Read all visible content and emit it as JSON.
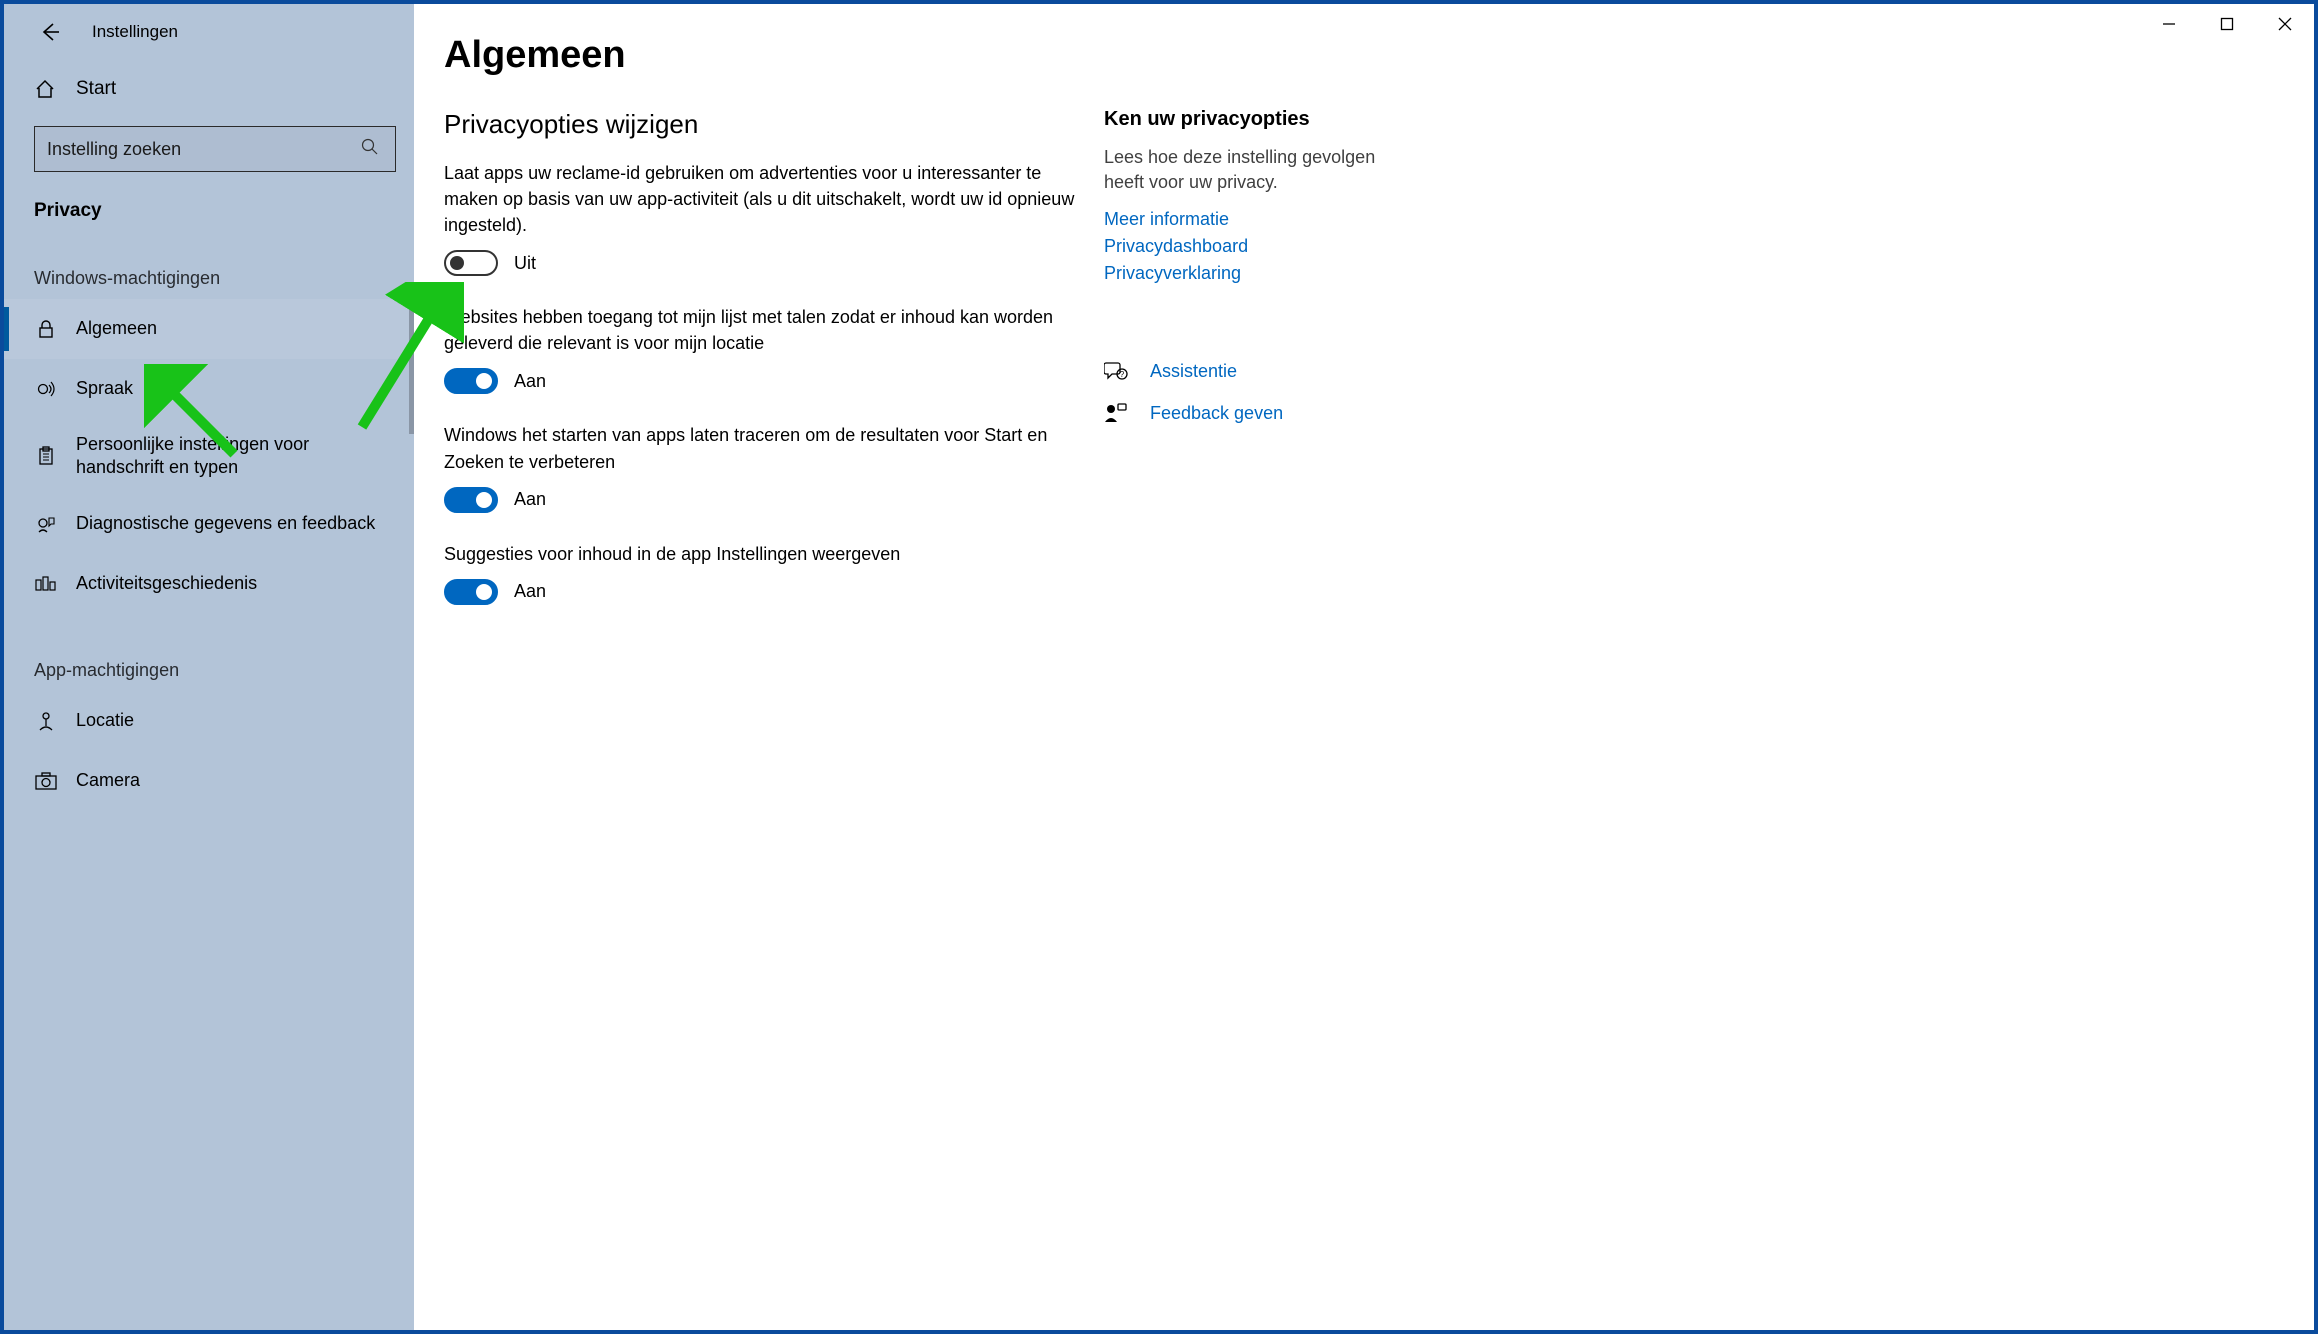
{
  "window_title": "Instellingen",
  "sidebar": {
    "start_label": "Start",
    "search_placeholder": "Instelling zoeken",
    "section": "Privacy",
    "group_windows": "Windows-machtigingen",
    "group_apps": "App-machtigingen",
    "items_windows": [
      {
        "label": "Algemeen",
        "icon": "lock",
        "active": true
      },
      {
        "label": "Spraak",
        "icon": "speech",
        "active": false
      },
      {
        "label": "Persoonlijke instellingen voor handschrift en typen",
        "icon": "clipboard",
        "active": false
      },
      {
        "label": "Diagnostische gegevens en feedback",
        "icon": "feedback",
        "active": false
      },
      {
        "label": "Activiteitsgeschiedenis",
        "icon": "history",
        "active": false
      }
    ],
    "items_apps": [
      {
        "label": "Locatie",
        "icon": "location",
        "active": false
      },
      {
        "label": "Camera",
        "icon": "camera",
        "active": false
      }
    ]
  },
  "main": {
    "title": "Algemeen",
    "subsection": "Privacyopties wijzigen",
    "settings": [
      {
        "desc": "Laat apps uw reclame-id gebruiken om advertenties voor u interessanter te maken op basis van uw app-activiteit (als u dit uitschakelt, wordt uw id opnieuw ingesteld).",
        "on": false
      },
      {
        "desc": "Websites hebben toegang tot mijn lijst met talen zodat er inhoud kan worden geleverd die relevant is voor mijn locatie",
        "on": true
      },
      {
        "desc": "Windows het starten van apps laten traceren om de resultaten voor Start en Zoeken te verbeteren",
        "on": true
      },
      {
        "desc": "Suggesties voor inhoud in de app Instellingen weergeven",
        "on": true
      }
    ],
    "state_on": "Aan",
    "state_off": "Uit"
  },
  "right": {
    "heading": "Ken uw privacyopties",
    "text": "Lees hoe deze instelling gevolgen heeft voor uw privacy.",
    "links": [
      "Meer informatie",
      "Privacydashboard",
      "Privacyverklaring"
    ],
    "help": "Assistentie",
    "feedback": "Feedback geven"
  }
}
